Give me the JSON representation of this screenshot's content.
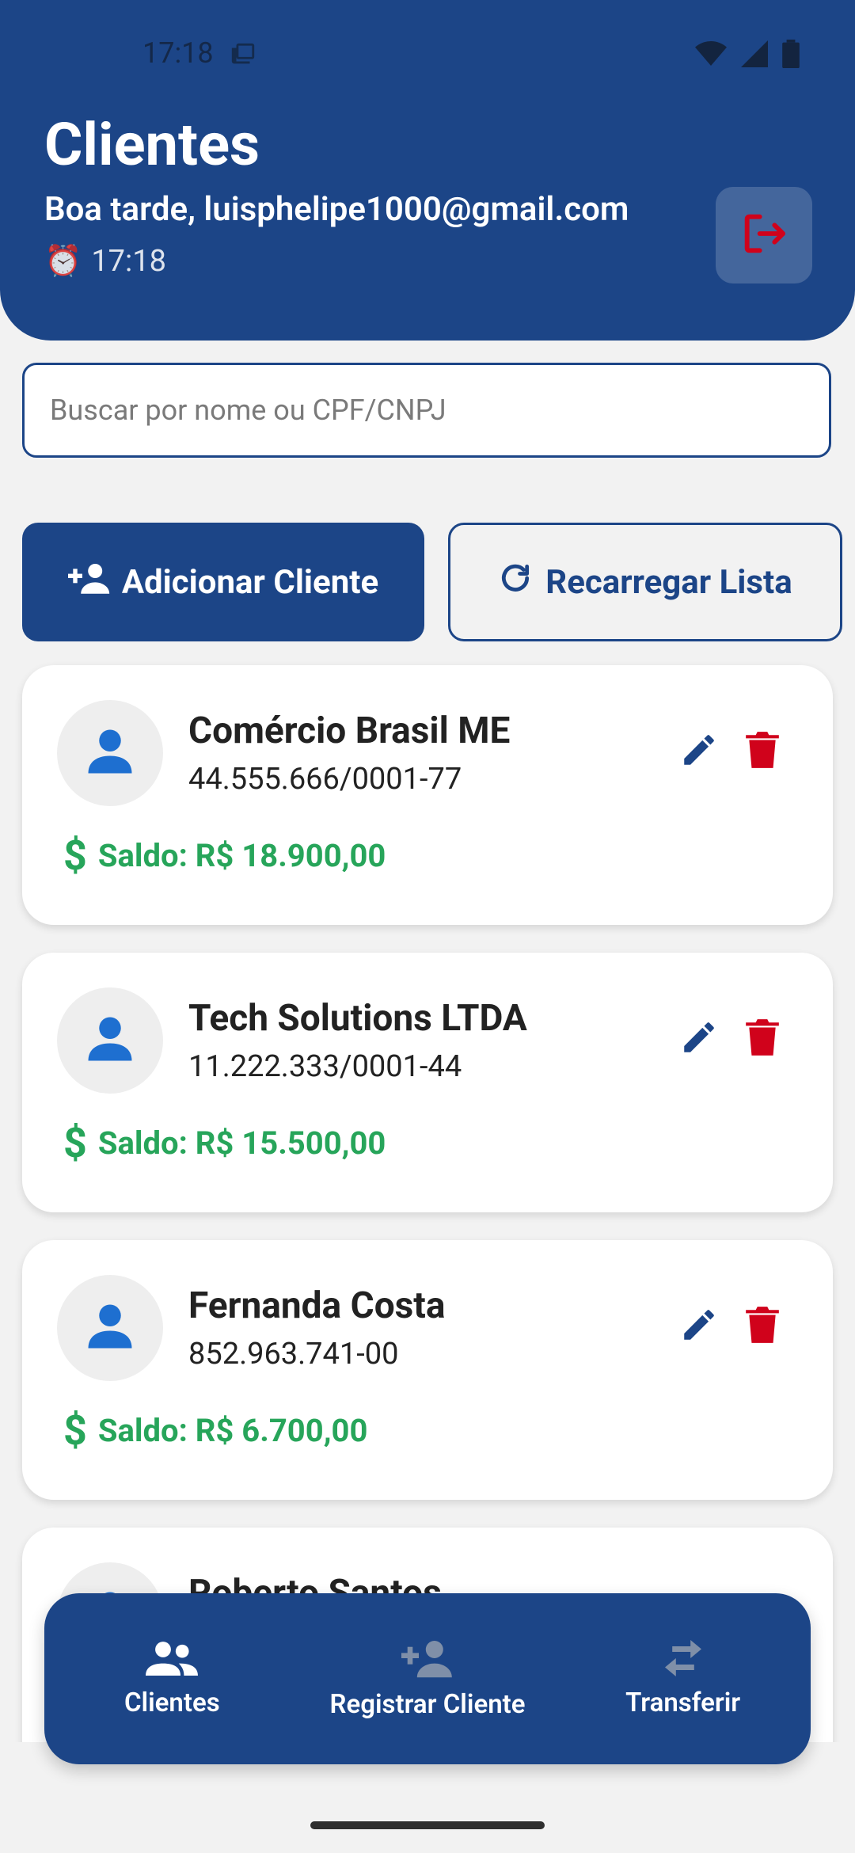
{
  "status_bar": {
    "time": "17:18"
  },
  "header": {
    "title": "Clientes",
    "greeting": "Boa tarde, luisphelipe1000@gmail.com",
    "clock_emoji": "⏰",
    "time": "17:18",
    "logout_icon": "logout-icon"
  },
  "search": {
    "placeholder": "Buscar por nome ou CPF/CNPJ"
  },
  "actions": {
    "add_label": "Adicionar Cliente",
    "reload_label": "Recarregar Lista"
  },
  "clients": [
    {
      "name": "Comércio Brasil ME",
      "document": "44.555.666/0001-77",
      "balance": "Saldo: R$ 18.900,00"
    },
    {
      "name": "Tech Solutions LTDA",
      "document": "11.222.333/0001-44",
      "balance": "Saldo: R$ 15.500,00"
    },
    {
      "name": "Fernanda Costa",
      "document": "852.963.741-00",
      "balance": "Saldo: R$ 6.700,00"
    },
    {
      "name": "Roberto Santos",
      "document": "",
      "balance": ""
    }
  ],
  "balance_symbol": "$",
  "bottom_nav": [
    {
      "label": "Clientes",
      "icon": "people-icon",
      "active": true
    },
    {
      "label": "Registrar Cliente",
      "icon": "person-add-icon",
      "active": false
    },
    {
      "label": "Transferir",
      "icon": "swap-icon",
      "active": false
    }
  ],
  "colors": {
    "primary": "#1c4587",
    "accent_red": "#d0021b",
    "balance_green": "#27a55a",
    "avatar_blue": "#1e6fd0"
  }
}
